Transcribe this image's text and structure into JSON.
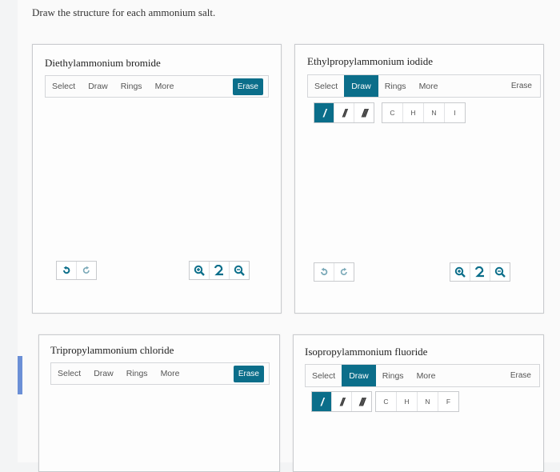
{
  "instruction": "Draw the structure for each ammonium salt.",
  "colors": {
    "accent": "#0b6e8a"
  },
  "panels": [
    {
      "title": "Diethylammonium bromide",
      "toolbar": {
        "select": "Select",
        "draw": "Draw",
        "rings": "Rings",
        "more": "More",
        "erase": "Erase"
      }
    },
    {
      "title": "Ethylpropylammonium iodide",
      "toolbar": {
        "select": "Select",
        "draw": "Draw",
        "rings": "Rings",
        "more": "More",
        "erase": "Erase"
      },
      "atoms": [
        "C",
        "H",
        "N",
        "I"
      ]
    },
    {
      "title": "Tripropylammonium chloride",
      "toolbar": {
        "select": "Select",
        "draw": "Draw",
        "rings": "Rings",
        "more": "More",
        "erase": "Erase"
      }
    },
    {
      "title": "Isopropylammonium fluoride",
      "toolbar": {
        "select": "Select",
        "draw": "Draw",
        "rings": "Rings",
        "more": "More",
        "erase": "Erase"
      },
      "atoms": [
        "C",
        "H",
        "N",
        "F"
      ]
    }
  ],
  "bond_buttons": [
    "single-bond",
    "double-bond",
    "triple-bond"
  ],
  "bond_labels": [
    "/",
    "//",
    "///"
  ],
  "icons": [
    "undo-icon",
    "redo-icon",
    "zoom-in-icon",
    "reset-zoom-icon",
    "zoom-out-icon"
  ]
}
